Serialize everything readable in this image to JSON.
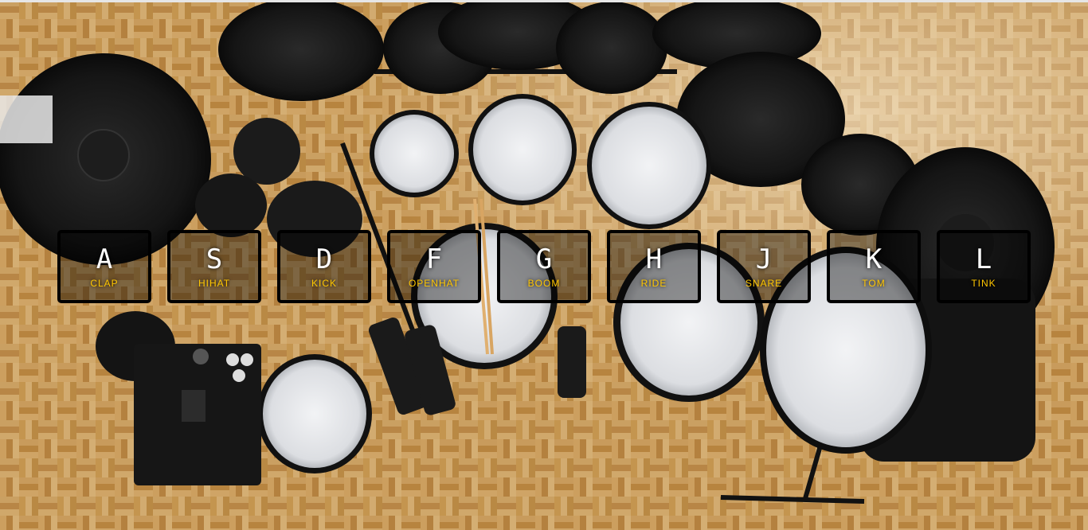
{
  "keys": [
    {
      "key": "A",
      "sound": "CLAP"
    },
    {
      "key": "S",
      "sound": "HIHAT"
    },
    {
      "key": "D",
      "sound": "KICK"
    },
    {
      "key": "F",
      "sound": "OPENHAT"
    },
    {
      "key": "G",
      "sound": "BOOM"
    },
    {
      "key": "H",
      "sound": "RIDE"
    },
    {
      "key": "J",
      "sound": "SNARE"
    },
    {
      "key": "K",
      "sound": "TOM"
    },
    {
      "key": "L",
      "sound": "TINK"
    }
  ],
  "colors": {
    "key_letter": "#ffffff",
    "sound_label": "#ffc600",
    "key_border": "#000000",
    "floor": "#b98a4e"
  }
}
